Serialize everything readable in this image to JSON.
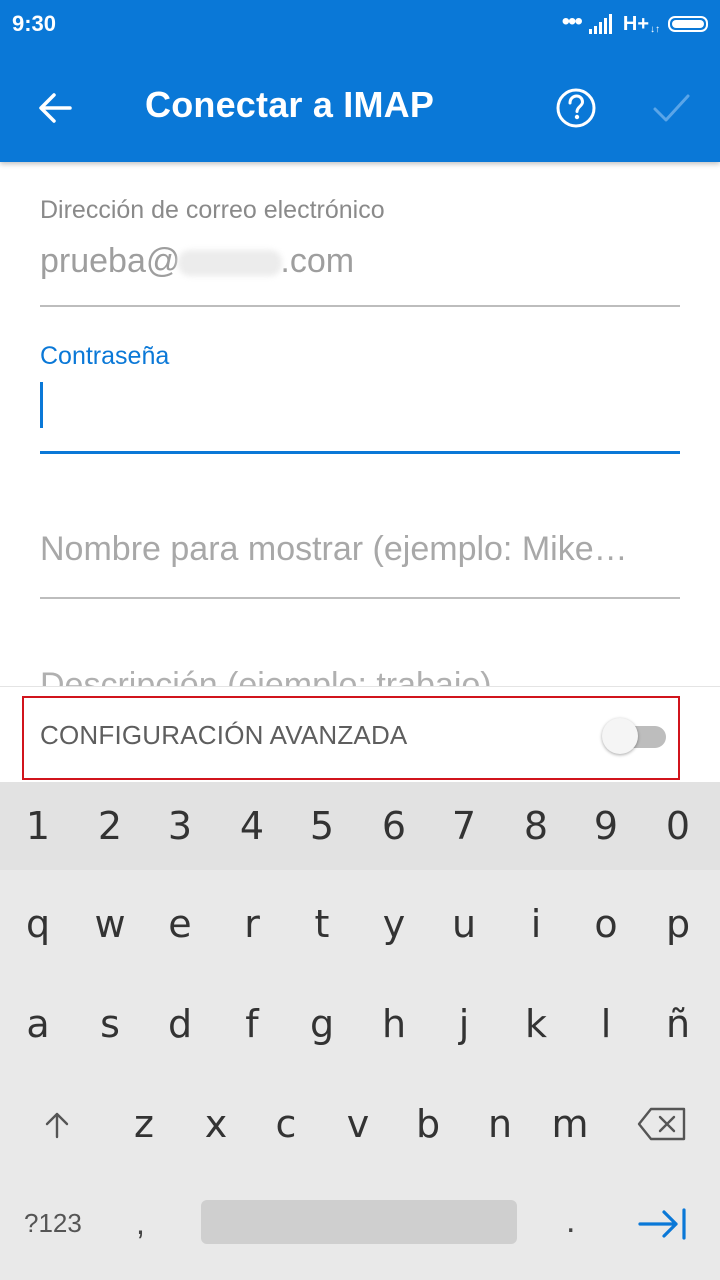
{
  "status_bar": {
    "time": "9:30",
    "signal_dots": "•••",
    "network": "H+",
    "network_sub": "↓↑"
  },
  "header": {
    "title": "Conectar a IMAP",
    "back_icon": "arrow-left-icon",
    "help_icon": "help-circle-icon",
    "confirm_icon": "check-icon"
  },
  "form": {
    "email": {
      "label": "Dirección de correo electrónico",
      "value_prefix": "prueba@",
      "value_suffix": ".com"
    },
    "password": {
      "label": "Contraseña",
      "value": ""
    },
    "display_name": {
      "placeholder": "Nombre para mostrar (ejemplo: Mike…"
    },
    "description_peek": "Descripción (ejemplo: trabajo)",
    "advanced": {
      "label": "CONFIGURACIÓN AVANZADA",
      "enabled": false
    }
  },
  "keyboard": {
    "numbers": [
      "1",
      "2",
      "3",
      "4",
      "5",
      "6",
      "7",
      "8",
      "9",
      "0"
    ],
    "row1": [
      "q",
      "w",
      "e",
      "r",
      "t",
      "y",
      "u",
      "i",
      "o",
      "p"
    ],
    "row2": [
      "a",
      "s",
      "d",
      "f",
      "g",
      "h",
      "j",
      "k",
      "l",
      "ñ"
    ],
    "row3": [
      "z",
      "x",
      "c",
      "v",
      "b",
      "n",
      "m"
    ],
    "symbols_label": "?123",
    "comma": ",",
    "period": "."
  },
  "colors": {
    "accent": "#0a78d7",
    "highlight_border": "#d1141c"
  }
}
